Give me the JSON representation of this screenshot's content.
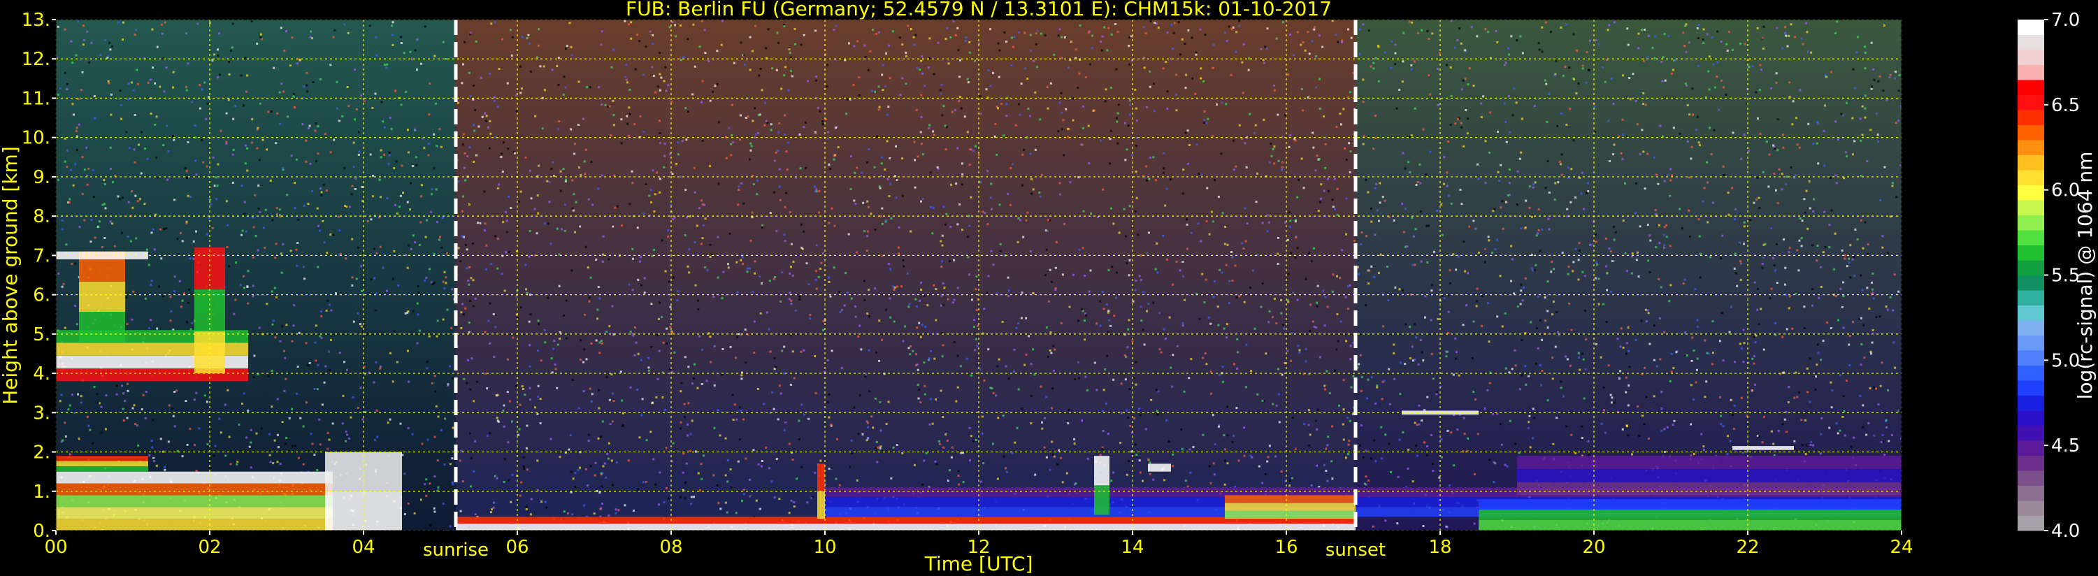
{
  "chart_data": {
    "type": "heatmap",
    "title": "FUB: Berlin FU (Germany; 52.4579 N / 13.3101 E):    CHM15k: 01-10-2017",
    "xlabel": "Time [UTC]",
    "ylabel": "Height above ground [km]",
    "xlim": [
      0,
      24
    ],
    "ylim": [
      0,
      13
    ],
    "x_ticks": [
      "00",
      "02",
      "04",
      "06",
      "08",
      "10",
      "12",
      "14",
      "16",
      "18",
      "20",
      "22",
      "24"
    ],
    "y_ticks": [
      "0.",
      "1.",
      "2.",
      "3.",
      "4.",
      "5.",
      "6.",
      "7.",
      "8.",
      "9.",
      "10.",
      "11.",
      "12.",
      "13."
    ],
    "grid": true,
    "markers": [
      {
        "label": "sunrise",
        "x": 5.2
      },
      {
        "label": "sunset",
        "x": 16.9
      }
    ],
    "colorbar": {
      "label": "log(rc-signal) @ 1064 nm",
      "range": [
        4.0,
        7.0
      ],
      "ticks": [
        "4.0",
        "4.5",
        "5.0",
        "5.5",
        "6.0",
        "6.5",
        "7.0"
      ],
      "colors": [
        "#a8a0a8",
        "#9a8a9a",
        "#8a6f8e",
        "#7a4f8a",
        "#6c2f8c",
        "#5a1a9a",
        "#4010b0",
        "#2a10c8",
        "#1a20e0",
        "#2040ff",
        "#3060ff",
        "#5080ff",
        "#6a9af8",
        "#80b0f0",
        "#60c8d0",
        "#30b0a0",
        "#109060",
        "#10a040",
        "#20c030",
        "#50e040",
        "#90f050",
        "#c8f850",
        "#ffff40",
        "#ffe030",
        "#ffc020",
        "#ff9010",
        "#ff6000",
        "#ff3000",
        "#ff1010",
        "#ff0000",
        "#f8b0b0",
        "#f0d0d0",
        "#e8e0e0",
        "#ffffff"
      ]
    },
    "background_bands": [
      {
        "x": [
          0,
          5.2
        ],
        "y": [
          0,
          13
        ],
        "low": "#1a3060",
        "high": "#40a090"
      },
      {
        "x": [
          5.2,
          16.9
        ],
        "y": [
          0,
          13
        ],
        "low": "#3040a0",
        "high": "#c07050"
      },
      {
        "x": [
          16.9,
          24
        ],
        "y": [
          0,
          13
        ],
        "low": "#3a2a9a",
        "high": "#6aa070"
      }
    ],
    "layers": [
      {
        "x": [
          0,
          3.6
        ],
        "y": [
          0,
          1.5
        ],
        "colors": [
          "#ffe030",
          "#ffff60",
          "#90f050",
          "#ff6000",
          "#ffffff"
        ]
      },
      {
        "x": [
          0,
          1.2
        ],
        "y": [
          1.5,
          1.9
        ],
        "colors": [
          "#20c030",
          "#ffe030",
          "#ff3000"
        ]
      },
      {
        "x": [
          0,
          2.5
        ],
        "y": [
          3.8,
          5.1
        ],
        "colors": [
          "#ff1010",
          "#ffffff",
          "#ffe030",
          "#20c030"
        ]
      },
      {
        "x": [
          0.3,
          0.9
        ],
        "y": [
          4.8,
          7.1
        ],
        "colors": [
          "#20c030",
          "#ffe030",
          "#ff6000"
        ]
      },
      {
        "x": [
          1.8,
          2.2
        ],
        "y": [
          4.0,
          7.2
        ],
        "colors": [
          "#ffe030",
          "#20c030",
          "#ff1010"
        ]
      },
      {
        "x": [
          0,
          1.2
        ],
        "y": [
          6.9,
          7.1
        ],
        "colors": [
          "#ffffff"
        ]
      },
      {
        "x": [
          3.5,
          4.5
        ],
        "y": [
          0,
          2.0
        ],
        "colors": [
          "#ffffff",
          "#f0f0f0"
        ]
      },
      {
        "x": [
          5.2,
          16.9
        ],
        "y": [
          0,
          0.35
        ],
        "colors": [
          "#ffffff",
          "#ff3000"
        ]
      },
      {
        "x": [
          10.0,
          24
        ],
        "y": [
          0.35,
          1.1
        ],
        "colors": [
          "#2040ff",
          "#1a20e0",
          "#5a1a9a"
        ]
      },
      {
        "x": [
          15.2,
          16.9
        ],
        "y": [
          0.3,
          0.9
        ],
        "colors": [
          "#90f050",
          "#ffe030",
          "#ff6000"
        ]
      },
      {
        "x": [
          18.5,
          24
        ],
        "y": [
          0,
          0.8
        ],
        "colors": [
          "#50e040",
          "#20c030",
          "#2040ff"
        ]
      },
      {
        "x": [
          19.0,
          24
        ],
        "y": [
          0.9,
          1.9
        ],
        "colors": [
          "#6c2f8c",
          "#2a10c8",
          "#5a1a9a"
        ]
      },
      {
        "x": [
          21.8,
          22.6
        ],
        "y": [
          2.05,
          2.15
        ],
        "colors": [
          "#ffffff"
        ]
      },
      {
        "x": [
          17.5,
          18.5
        ],
        "y": [
          2.95,
          3.05
        ],
        "colors": [
          "#ffffff"
        ]
      },
      {
        "x": [
          14.2,
          14.5
        ],
        "y": [
          1.5,
          1.7
        ],
        "colors": [
          "#ffffff"
        ]
      },
      {
        "x": [
          9.9,
          10.0
        ],
        "y": [
          0.3,
          1.7
        ],
        "colors": [
          "#ffe030",
          "#ff3000"
        ]
      },
      {
        "x": [
          13.5,
          13.7
        ],
        "y": [
          0.4,
          1.9
        ],
        "colors": [
          "#20c030",
          "#ffffff"
        ]
      }
    ]
  }
}
